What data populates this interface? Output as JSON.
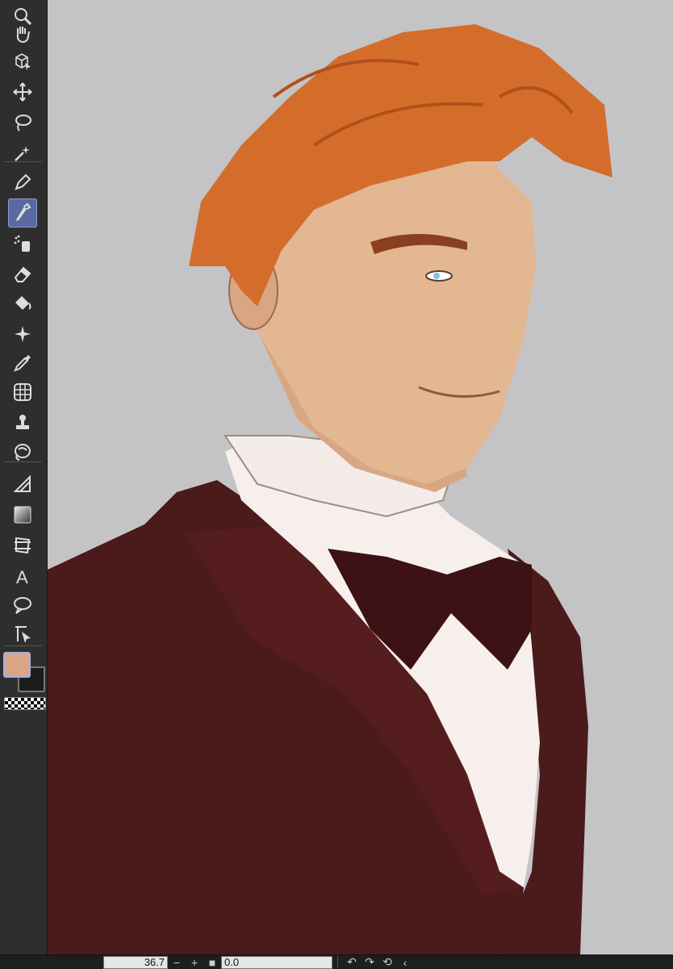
{
  "toolbar": {
    "tools": [
      {
        "name": "zoom-tool",
        "icon": "zoom-icon"
      },
      {
        "name": "hand-tool",
        "icon": "hand-icon"
      },
      {
        "name": "object-tool",
        "icon": "object-select-icon"
      },
      {
        "name": "move-tool",
        "icon": "move-arrows-icon"
      },
      {
        "name": "lasso-tool",
        "icon": "lasso-icon"
      },
      {
        "name": "magic-wand-tool",
        "icon": "magic-wand-icon"
      },
      {
        "name": "pen-tool",
        "icon": "pen-icon"
      },
      {
        "name": "brush-tool",
        "icon": "brush-icon",
        "active": true
      },
      {
        "name": "airbrush-tool",
        "icon": "airbrush-icon"
      },
      {
        "name": "eraser-tool",
        "icon": "eraser-icon"
      },
      {
        "name": "fill-tool",
        "icon": "fill-bucket-icon"
      },
      {
        "name": "decoration-tool",
        "icon": "sparkle-icon"
      },
      {
        "name": "eyedropper-tool",
        "icon": "eyedropper-icon"
      },
      {
        "name": "figure-tool",
        "icon": "grid-sphere-icon"
      },
      {
        "name": "stamp-tool",
        "icon": "stamp-icon"
      },
      {
        "name": "blend-tool",
        "icon": "blend-icon"
      },
      {
        "name": "ruler-tool",
        "icon": "ruler-triangle-icon"
      },
      {
        "name": "gradient-tool",
        "icon": "gradient-icon"
      },
      {
        "name": "frame-tool",
        "icon": "frame-border-icon"
      },
      {
        "name": "text-tool",
        "icon": "text-a-icon",
        "label": "A"
      },
      {
        "name": "balloon-tool",
        "icon": "speech-balloon-icon"
      },
      {
        "name": "correct-line-tool",
        "icon": "correct-line-icon"
      }
    ],
    "colors": {
      "main": "#d9a585",
      "sub": "#1c1c1c"
    }
  },
  "statusbar": {
    "zoom_value": "36.7",
    "zoom_out": "−",
    "zoom_in": "+",
    "rotate_value": "0.0",
    "undo": "↶",
    "redo": "↷",
    "reset_rotation": "⟲",
    "collapse": "‹"
  },
  "palette": {
    "background": "#c4c4c6",
    "jacket": "#4b1a1b",
    "shirt": "#f6efec",
    "skin": "#e2b792",
    "hair": "#d46d2c",
    "bowtie": "#3d1215"
  }
}
